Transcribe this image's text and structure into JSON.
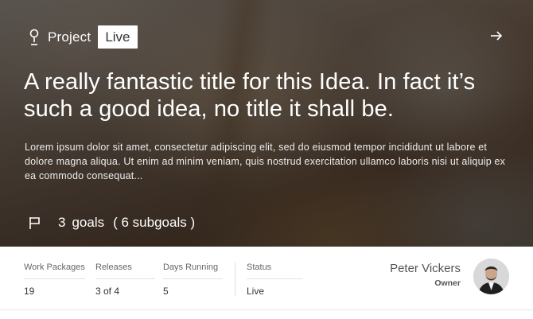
{
  "header": {
    "project_label": "Project",
    "status_badge": "Live"
  },
  "hero": {
    "title": "A really fantastic title for this Idea. In fact it’s such a good idea, no title it shall be.",
    "description": "Lorem ipsum dolor sit amet, consectetur adipiscing elit, sed do eiusmod tempor incididunt ut labore et dolore magna aliqua. Ut enim ad minim veniam, quis nostrud exercitation ullamco laboris nisi ut aliquip ex ea commodo consequat..."
  },
  "goals": {
    "count": "3",
    "label": "goals",
    "subgoals": "( 6 subgoals )"
  },
  "stats": [
    {
      "label": "Work Packages",
      "value": "19"
    },
    {
      "label": "Releases",
      "value": "3 of 4"
    },
    {
      "label": "Days Running",
      "value": "5"
    },
    {
      "label": "Status",
      "value": "Live"
    }
  ],
  "owner": {
    "name": "Peter Vickers",
    "role": "Owner"
  },
  "icons": {
    "pin": "pin-icon",
    "arrow": "arrow-right-icon",
    "flag": "flag-icon"
  }
}
